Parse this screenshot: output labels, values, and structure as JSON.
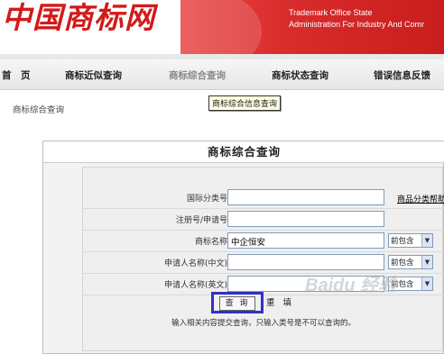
{
  "header": {
    "logo_text": "中国商标网",
    "banner_line1": "Trademark Office State",
    "banner_line2": "Administration For Industry And Comr"
  },
  "nav": {
    "items": [
      {
        "label": "首　页"
      },
      {
        "label": "商标近似查询"
      },
      {
        "label": "商标综合查询"
      },
      {
        "label": "商标状态查询"
      },
      {
        "label": "错误信息反馈"
      }
    ],
    "active_index": 2
  },
  "tooltip": "商标综合信息查询",
  "breadcrumb": "商标综合查询",
  "form": {
    "title": "商标综合查询",
    "fields": [
      {
        "label": "国际分类号",
        "value": "",
        "extra_link": "商品分类帮助"
      },
      {
        "label": "注册号/申请号",
        "value": ""
      },
      {
        "label": "商标名称",
        "value": "中企恒安",
        "match": "前包含"
      },
      {
        "label": "申请人名称(中文)",
        "value": "",
        "match": "前包含"
      },
      {
        "label": "申请人名称(英文)",
        "value": "",
        "match": "前包含"
      }
    ],
    "submit_label": "查 询",
    "reset_label": "重 填",
    "hint": "输入相关内容提交查询，只输入类号是不可以查询的。"
  },
  "watermark": "Baidu 经验",
  "colors": {
    "brand_red": "#d21a1a",
    "focus_border": "#3030c8"
  }
}
